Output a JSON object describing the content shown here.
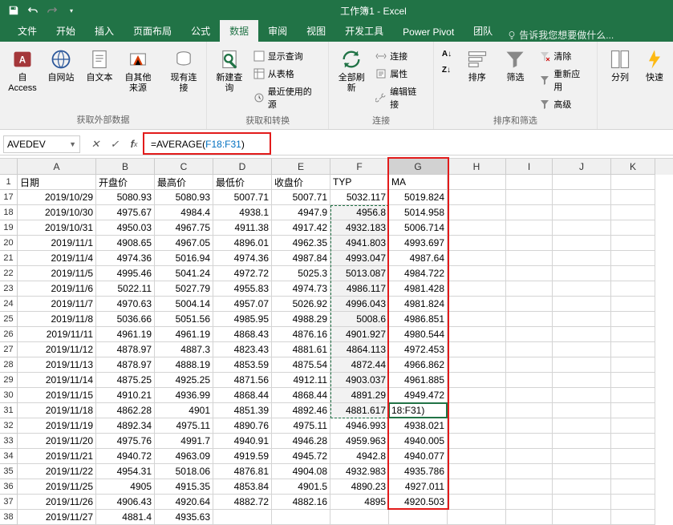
{
  "app": {
    "title": "工作簿1 - Excel"
  },
  "qat": {
    "save": "保存",
    "undo": "撤销",
    "redo": "重做"
  },
  "tabs": {
    "file": "文件",
    "home": "开始",
    "insert": "插入",
    "layout": "页面布局",
    "formula": "公式",
    "data": "数据",
    "review": "审阅",
    "view": "视图",
    "dev": "开发工具",
    "pivot": "Power Pivot",
    "team": "团队",
    "tellme": "告诉我您想要做什么..."
  },
  "ribbon": {
    "group1": {
      "access": "自 Access",
      "web": "自网站",
      "text": "自文本",
      "other": "自其他来源",
      "existing": "现有连接",
      "label": "获取外部数据"
    },
    "group2": {
      "newquery": "新建查询",
      "showquery": "显示查询",
      "fromtable": "从表格",
      "recent": "最近使用的源",
      "label": "获取和转换"
    },
    "group3": {
      "refresh": "全部刷新",
      "conn": "连接",
      "prop": "属性",
      "editlink": "编辑链接",
      "label": "连接"
    },
    "group4": {
      "az": "A↓Z",
      "za": "Z↓A",
      "sort": "排序",
      "filter": "筛选",
      "clear": "清除",
      "reapply": "重新应用",
      "adv": "高级",
      "label": "排序和筛选"
    },
    "group5": {
      "split": "分列",
      "flash": "快速"
    }
  },
  "namebox": "AVEDEV",
  "formula": {
    "prefix": "=AVERAGE(",
    "ref": "F18:F31",
    "suffix": ")"
  },
  "colheaders": [
    "A",
    "B",
    "C",
    "D",
    "E",
    "F",
    "G",
    "H",
    "I",
    "J",
    "K"
  ],
  "headers": {
    "date": "日期",
    "open": "开盘价",
    "high": "最高价",
    "low": "最低价",
    "close": "收盘价",
    "typ": "TYP",
    "ma": "MA"
  },
  "rows": [
    {
      "n": 17,
      "d": "2019/10/29",
      "o": "5080.93",
      "h": "5080.93",
      "l": "5007.71",
      "c": "5007.71",
      "t": "5032.117",
      "m": "5019.824"
    },
    {
      "n": 18,
      "d": "2019/10/30",
      "o": "4975.67",
      "h": "4984.4",
      "l": "4938.1",
      "c": "4947.9",
      "t": "4956.8",
      "m": "5014.958"
    },
    {
      "n": 19,
      "d": "2019/10/31",
      "o": "4950.03",
      "h": "4967.75",
      "l": "4911.38",
      "c": "4917.42",
      "t": "4932.183",
      "m": "5006.714"
    },
    {
      "n": 20,
      "d": "2019/11/1",
      "o": "4908.65",
      "h": "4967.05",
      "l": "4896.01",
      "c": "4962.35",
      "t": "4941.803",
      "m": "4993.697"
    },
    {
      "n": 21,
      "d": "2019/11/4",
      "o": "4974.36",
      "h": "5016.94",
      "l": "4974.36",
      "c": "4987.84",
      "t": "4993.047",
      "m": "4987.64"
    },
    {
      "n": 22,
      "d": "2019/11/5",
      "o": "4995.46",
      "h": "5041.24",
      "l": "4972.72",
      "c": "5025.3",
      "t": "5013.087",
      "m": "4984.722"
    },
    {
      "n": 23,
      "d": "2019/11/6",
      "o": "5022.11",
      "h": "5027.79",
      "l": "4955.83",
      "c": "4974.73",
      "t": "4986.117",
      "m": "4981.428"
    },
    {
      "n": 24,
      "d": "2019/11/7",
      "o": "4970.63",
      "h": "5004.14",
      "l": "4957.07",
      "c": "5026.92",
      "t": "4996.043",
      "m": "4981.824"
    },
    {
      "n": 25,
      "d": "2019/11/8",
      "o": "5036.66",
      "h": "5051.56",
      "l": "4985.95",
      "c": "4988.29",
      "t": "5008.6",
      "m": "4986.851"
    },
    {
      "n": 26,
      "d": "2019/11/11",
      "o": "4961.19",
      "h": "4961.19",
      "l": "4868.43",
      "c": "4876.16",
      "t": "4901.927",
      "m": "4980.544"
    },
    {
      "n": 27,
      "d": "2019/11/12",
      "o": "4878.97",
      "h": "4887.3",
      "l": "4823.43",
      "c": "4881.61",
      "t": "4864.113",
      "m": "4972.453"
    },
    {
      "n": 28,
      "d": "2019/11/13",
      "o": "4878.97",
      "h": "4888.19",
      "l": "4853.59",
      "c": "4875.54",
      "t": "4872.44",
      "m": "4966.862"
    },
    {
      "n": 29,
      "d": "2019/11/14",
      "o": "4875.25",
      "h": "4925.25",
      "l": "4871.56",
      "c": "4912.11",
      "t": "4903.037",
      "m": "4961.885"
    },
    {
      "n": 30,
      "d": "2019/11/15",
      "o": "4910.21",
      "h": "4936.99",
      "l": "4868.44",
      "c": "4868.44",
      "t": "4891.29",
      "m": "4949.472"
    },
    {
      "n": 31,
      "d": "2019/11/18",
      "o": "4862.28",
      "h": "4901",
      "l": "4851.39",
      "c": "4892.46",
      "t": "4881.617",
      "m": "18:F31)"
    },
    {
      "n": 32,
      "d": "2019/11/19",
      "o": "4892.34",
      "h": "4975.11",
      "l": "4890.76",
      "c": "4975.11",
      "t": "4946.993",
      "m": "4938.021"
    },
    {
      "n": 33,
      "d": "2019/11/20",
      "o": "4975.76",
      "h": "4991.7",
      "l": "4940.91",
      "c": "4946.28",
      "t": "4959.963",
      "m": "4940.005"
    },
    {
      "n": 34,
      "d": "2019/11/21",
      "o": "4940.72",
      "h": "4963.09",
      "l": "4919.59",
      "c": "4945.72",
      "t": "4942.8",
      "m": "4940.077"
    },
    {
      "n": 35,
      "d": "2019/11/22",
      "o": "4954.31",
      "h": "5018.06",
      "l": "4876.81",
      "c": "4904.08",
      "t": "4932.983",
      "m": "4935.786"
    },
    {
      "n": 36,
      "d": "2019/11/25",
      "o": "4905",
      "h": "4915.35",
      "l": "4853.84",
      "c": "4901.5",
      "t": "4890.23",
      "m": "4927.011"
    },
    {
      "n": 37,
      "d": "2019/11/26",
      "o": "4906.43",
      "h": "4920.64",
      "l": "4882.72",
      "c": "4882.16",
      "t": "4895",
      "m": "4920.503"
    },
    {
      "n": 38,
      "d": "2019/11/27",
      "o": "4881.4",
      "h": "4935.63",
      "l": "",
      "c": "",
      "t": "",
      "m": ""
    }
  ],
  "headerRowNum": "1"
}
